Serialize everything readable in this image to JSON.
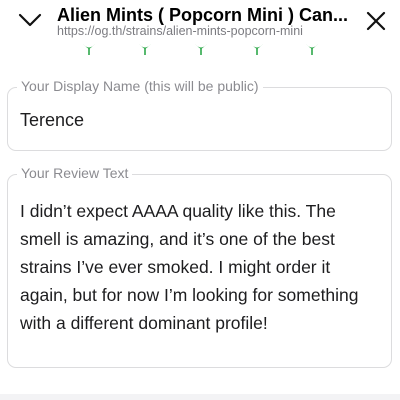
{
  "header": {
    "title": "Alien Mints ( Popcorn Mini ) Can...",
    "url": "https://og.th/strains/alien-mints-popcorn-mini",
    "leaf_color": "#2ea84a"
  },
  "form": {
    "display_name": {
      "label": "Your Display Name (this will be public)",
      "value": "Terence"
    },
    "review_text": {
      "label": "Your Review Text",
      "value": "I didn’t expect AAAA quality like this. The smell is amazing, and it’s one of the best strains I’ve ever smoked. I might order it again, but for now I’m looking for something with a different dominant profile!"
    }
  }
}
